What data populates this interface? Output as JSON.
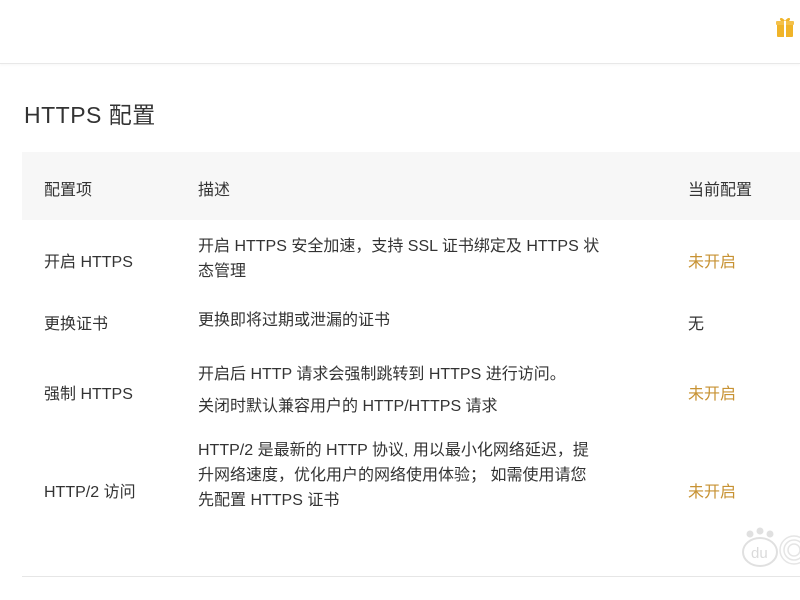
{
  "header": {
    "gift_icon": "gift-icon"
  },
  "section": {
    "title": "HTTPS 配置"
  },
  "table": {
    "headers": {
      "item": "配置项",
      "desc": "描述",
      "current": "当前配置"
    },
    "rows": [
      {
        "item": "开启 HTTPS",
        "desc_lines": [
          "开启 HTTPS 安全加速，支持 SSL 证书绑定及 HTTPS 状",
          "态管理"
        ],
        "status": "未开启"
      },
      {
        "item": "更换证书",
        "desc_lines": [
          "更换即将过期或泄漏的证书"
        ],
        "status": "无"
      },
      {
        "item": "强制 HTTPS",
        "desc_lines": [
          "开启后 HTTP 请求会强制跳转到 HTTPS 进行访问。",
          "关闭时默认兼容用户的 HTTP/HTTPS 请求"
        ],
        "status": "未开启"
      },
      {
        "item": "HTTP/2 访问",
        "desc_lines": [
          "HTTP/2 是最新的 HTTP 协议, 用以最小化网络延迟，提",
          "升网络速度，优化用户的网络使用体验； 如需使用请您",
          "先配置 HTTPS 证书"
        ],
        "status": "未开启"
      }
    ]
  },
  "colors": {
    "status_off": "#c79233",
    "header_bg": "#f7f7f7",
    "gift": "#f0b429"
  },
  "watermark": {
    "text": "du"
  }
}
